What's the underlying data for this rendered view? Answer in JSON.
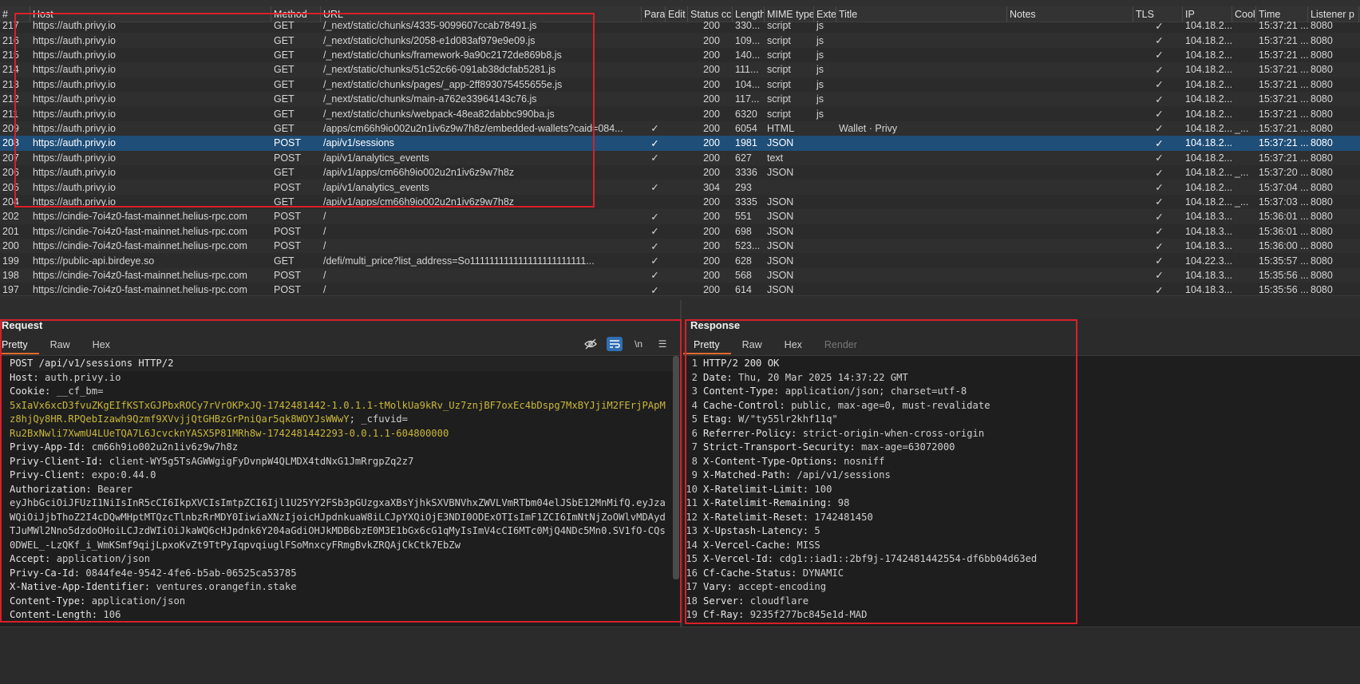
{
  "table": {
    "columns": [
      "#",
      "Host",
      "Method",
      "URL",
      "Params",
      "Edited",
      "Status code",
      "Length",
      "MIME type",
      "Extension",
      "Title",
      "Notes",
      "TLS",
      "IP",
      "Cookies",
      "Time",
      "Listener port"
    ],
    "headers": {
      "num": "#",
      "host": "Host",
      "method": "Method",
      "url": "URL",
      "params": "Parar",
      "edited": "Edit",
      "status": "Status cc",
      "length": "Length",
      "mime": "MIME type",
      "ext": "Exter",
      "title": "Title",
      "notes": "Notes",
      "tls": "TLS",
      "ip": "IP",
      "cookies": "Cool",
      "time": "Time",
      "listener": "Listener p"
    },
    "rows": [
      {
        "num": "217",
        "host": "https://auth.privy.io",
        "method": "GET",
        "url": "/_next/static/chunks/4335-9099607ccab78491.js",
        "params": "",
        "status": "200",
        "length": "330...",
        "mime": "script",
        "ext": "js",
        "title": "",
        "tls": "✓",
        "ip": "104.18.2...",
        "cookies": "",
        "time": "15:37:21 ...",
        "listener": "8080"
      },
      {
        "num": "216",
        "host": "https://auth.privy.io",
        "method": "GET",
        "url": "/_next/static/chunks/2058-e1d083af979e9e09.js",
        "params": "",
        "status": "200",
        "length": "109...",
        "mime": "script",
        "ext": "js",
        "title": "",
        "tls": "✓",
        "ip": "104.18.2...",
        "cookies": "",
        "time": "15:37:21 ...",
        "listener": "8080"
      },
      {
        "num": "215",
        "host": "https://auth.privy.io",
        "method": "GET",
        "url": "/_next/static/chunks/framework-9a90c2172de869b8.js",
        "params": "",
        "status": "200",
        "length": "140...",
        "mime": "script",
        "ext": "js",
        "title": "",
        "tls": "✓",
        "ip": "104.18.2...",
        "cookies": "",
        "time": "15:37:21 ...",
        "listener": "8080"
      },
      {
        "num": "214",
        "host": "https://auth.privy.io",
        "method": "GET",
        "url": "/_next/static/chunks/51c52c66-091ab38dcfab5281.js",
        "params": "",
        "status": "200",
        "length": "111...",
        "mime": "script",
        "ext": "js",
        "title": "",
        "tls": "✓",
        "ip": "104.18.2...",
        "cookies": "",
        "time": "15:37:21 ...",
        "listener": "8080"
      },
      {
        "num": "213",
        "host": "https://auth.privy.io",
        "method": "GET",
        "url": "/_next/static/chunks/pages/_app-2ff893075455655e.js",
        "params": "",
        "status": "200",
        "length": "104...",
        "mime": "script",
        "ext": "js",
        "title": "",
        "tls": "✓",
        "ip": "104.18.2...",
        "cookies": "",
        "time": "15:37:21 ...",
        "listener": "8080"
      },
      {
        "num": "212",
        "host": "https://auth.privy.io",
        "method": "GET",
        "url": "/_next/static/chunks/main-a762e33964143c76.js",
        "params": "",
        "status": "200",
        "length": "117...",
        "mime": "script",
        "ext": "js",
        "title": "",
        "tls": "✓",
        "ip": "104.18.2...",
        "cookies": "",
        "time": "15:37:21 ...",
        "listener": "8080"
      },
      {
        "num": "211",
        "host": "https://auth.privy.io",
        "method": "GET",
        "url": "/_next/static/chunks/webpack-48ea82dabbc990ba.js",
        "params": "",
        "status": "200",
        "length": "6320",
        "mime": "script",
        "ext": "js",
        "title": "",
        "tls": "✓",
        "ip": "104.18.2...",
        "cookies": "",
        "time": "15:37:21 ...",
        "listener": "8080"
      },
      {
        "num": "209",
        "host": "https://auth.privy.io",
        "method": "GET",
        "url": "/apps/cm66h9io002u2n1iv6z9w7h8z/embedded-wallets?caid=084...",
        "params": "✓",
        "status": "200",
        "length": "6054",
        "mime": "HTML",
        "ext": "",
        "title": "Wallet · Privy",
        "tls": "✓",
        "ip": "104.18.2...",
        "cookies": "_...",
        "time": "15:37:21 ...",
        "listener": "8080"
      },
      {
        "num": "208",
        "host": "https://auth.privy.io",
        "method": "POST",
        "url": "/api/v1/sessions",
        "params": "✓",
        "status": "200",
        "length": "1981",
        "mime": "JSON",
        "ext": "",
        "title": "",
        "tls": "✓",
        "ip": "104.18.2...",
        "cookies": "",
        "time": "15:37:21 ...",
        "listener": "8080",
        "selected": true
      },
      {
        "num": "207",
        "host": "https://auth.privy.io",
        "method": "POST",
        "url": "/api/v1/analytics_events",
        "params": "✓",
        "status": "200",
        "length": "627",
        "mime": "text",
        "ext": "",
        "title": "",
        "tls": "✓",
        "ip": "104.18.2...",
        "cookies": "",
        "time": "15:37:21 ...",
        "listener": "8080"
      },
      {
        "num": "206",
        "host": "https://auth.privy.io",
        "method": "GET",
        "url": "/api/v1/apps/cm66h9io002u2n1iv6z9w7h8z",
        "params": "",
        "status": "200",
        "length": "3336",
        "mime": "JSON",
        "ext": "",
        "title": "",
        "tls": "✓",
        "ip": "104.18.2...",
        "cookies": "_...",
        "time": "15:37:20 ...",
        "listener": "8080"
      },
      {
        "num": "205",
        "host": "https://auth.privy.io",
        "method": "POST",
        "url": "/api/v1/analytics_events",
        "params": "✓",
        "status": "304",
        "length": "293",
        "mime": "",
        "ext": "",
        "title": "",
        "tls": "✓",
        "ip": "104.18.2...",
        "cookies": "",
        "time": "15:37:04 ...",
        "listener": "8080"
      },
      {
        "num": "204",
        "host": "https://auth.privy.io",
        "method": "GET",
        "url": "/api/v1/apps/cm66h9io002u2n1iv6z9w7h8z",
        "params": "",
        "status": "200",
        "length": "3335",
        "mime": "JSON",
        "ext": "",
        "title": "",
        "tls": "✓",
        "ip": "104.18.2...",
        "cookies": "_...",
        "time": "15:37:03 ...",
        "listener": "8080"
      },
      {
        "num": "202",
        "host": "https://cindie-7oi4z0-fast-mainnet.helius-rpc.com",
        "method": "POST",
        "url": "/",
        "params": "✓",
        "status": "200",
        "length": "551",
        "mime": "JSON",
        "ext": "",
        "title": "",
        "tls": "✓",
        "ip": "104.18.3...",
        "cookies": "",
        "time": "15:36:01 ...",
        "listener": "8080"
      },
      {
        "num": "201",
        "host": "https://cindie-7oi4z0-fast-mainnet.helius-rpc.com",
        "method": "POST",
        "url": "/",
        "params": "✓",
        "status": "200",
        "length": "698",
        "mime": "JSON",
        "ext": "",
        "title": "",
        "tls": "✓",
        "ip": "104.18.3...",
        "cookies": "",
        "time": "15:36:01 ...",
        "listener": "8080"
      },
      {
        "num": "200",
        "host": "https://cindie-7oi4z0-fast-mainnet.helius-rpc.com",
        "method": "POST",
        "url": "/",
        "params": "✓",
        "status": "200",
        "length": "523...",
        "mime": "JSON",
        "ext": "",
        "title": "",
        "tls": "✓",
        "ip": "104.18.3...",
        "cookies": "",
        "time": "15:36:00 ...",
        "listener": "8080"
      },
      {
        "num": "199",
        "host": "https://public-api.birdeye.so",
        "method": "GET",
        "url": "/defi/multi_price?list_address=So111111111111111111111111...",
        "params": "✓",
        "status": "200",
        "length": "628",
        "mime": "JSON",
        "ext": "",
        "title": "",
        "tls": "✓",
        "ip": "104.22.3...",
        "cookies": "",
        "time": "15:35:57 ...",
        "listener": "8080"
      },
      {
        "num": "198",
        "host": "https://cindie-7oi4z0-fast-mainnet.helius-rpc.com",
        "method": "POST",
        "url": "/",
        "params": "✓",
        "status": "200",
        "length": "568",
        "mime": "JSON",
        "ext": "",
        "title": "",
        "tls": "✓",
        "ip": "104.18.3...",
        "cookies": "",
        "time": "15:35:56 ...",
        "listener": "8080"
      },
      {
        "num": "197",
        "host": "https://cindie-7oi4z0-fast-mainnet.helius-rpc.com",
        "method": "POST",
        "url": "/",
        "params": "✓",
        "status": "200",
        "length": "614",
        "mime": "JSON",
        "ext": "",
        "title": "",
        "tls": "✓",
        "ip": "104.18.3...",
        "cookies": "",
        "time": "15:35:56 ...",
        "listener": "8080"
      }
    ]
  },
  "request": {
    "title": "Request",
    "tabs": [
      "Pretty",
      "Raw",
      "Hex"
    ],
    "tools": {
      "wrap": "\\n",
      "menu": "☰"
    },
    "lines": [
      {
        "k": "POST /api/v1/sessions HTTP/2",
        "v": ""
      },
      {
        "k": "Host: ",
        "v": "auth.privy.io"
      },
      {
        "k": "Cookie: ",
        "v": "__cf_bm="
      },
      {
        "g": "5xIaVx6xcD3fvuZKgEIfKSTxGJPbxROCy7rVrOKPxJQ-1742481442-1.0.1.1-tMolkUa9kRv_Uz7znjBF7oxEc4bDspg7MxBYJjiM2FErjPApM"
      },
      {
        "g": "z8hjQy8HR.RPQebIzawh9Qzmf9XVvjjQtGHBzGrPniQar5qk8WOYJsWWwY",
        "v": "; _cfuvid="
      },
      {
        "g": "Ru2BxNwli7XwmU4LUeTQA7L6JcvcknYASX5P81MRh8w-1742481442293-0.0.1.1-604800000"
      },
      {
        "k": "Privy-App-Id: ",
        "v": "cm66h9io002u2n1iv6z9w7h8z"
      },
      {
        "k": "Privy-Client-Id: ",
        "v": "client-WY5g5TsAGWWgigFyDvnpW4QLMDX4tdNxG1JmRrgpZq2z7"
      },
      {
        "k": "Privy-Client: ",
        "v": "expo:0.44.0"
      },
      {
        "k": "Authorization: ",
        "v": "Bearer"
      },
      {
        "v": "eyJhbGciOiJFUzI1NiIsInR5cCI6IkpXVCIsImtpZCI6Ijl1U25YY2FSb3pGUzgxaXBsYjhkSXVBNVhxZWVLVmRTbm04elJSbE12MnMifQ.eyJza"
      },
      {
        "v": "WQiOiJjbThoZ2I4cDQwMHptMTQzcTlnbzRrMDY0IiwiaXNzIjoicHJpdnkuaW8iLCJpYXQiOjE3NDI0ODExOTIsImF1ZCI6ImNtNjZoOWlvMDAyd"
      },
      {
        "v": "TJuMWl2Nno5dzdoOHoiLCJzdWIiOiJkaWQ6cHJpdnk6Y204aGdiOHJkMDB6bzE0M3E1bGx6cG1qMyIsImV4cCI6MTc0MjQ4NDc5Mn0.SV1fO-CQs"
      },
      {
        "v": "0DWEL_-LzQKf_i_WmKSmf9qijLpxoKvZt9TtPyIqpvqiuglFSoMnxcyFRmgBvkZRQAjCkCtk7EbZw"
      },
      {
        "k": "Accept: ",
        "v": "application/json"
      },
      {
        "k": "Privy-Ca-Id: ",
        "v": "0844fe4e-9542-4fe6-b5ab-06525ca53785"
      },
      {
        "k": "X-Native-App-Identifier: ",
        "v": "ventures.orangefin.stake"
      },
      {
        "k": "Content-Type: ",
        "v": "application/json"
      },
      {
        "k": "Content-Length: ",
        "v": "106"
      }
    ]
  },
  "response": {
    "title": "Response",
    "tabs": [
      "Pretty",
      "Raw",
      "Hex",
      "Render"
    ],
    "lines": [
      {
        "n": "1",
        "k": "HTTP/2 200 OK",
        "v": ""
      },
      {
        "n": "2",
        "k": "Date: ",
        "v": "Thu, 20 Mar 2025 14:37:22 GMT"
      },
      {
        "n": "3",
        "k": "Content-Type: ",
        "v": "application/json; charset=utf-8"
      },
      {
        "n": "4",
        "k": "Cache-Control: ",
        "v": "public, max-age=0, must-revalidate"
      },
      {
        "n": "5",
        "k": "Etag: ",
        "v": "W/\"ty55lr2khf11q\""
      },
      {
        "n": "6",
        "k": "Referrer-Policy: ",
        "v": "strict-origin-when-cross-origin"
      },
      {
        "n": "7",
        "k": "Strict-Transport-Security: ",
        "v": "max-age=63072000"
      },
      {
        "n": "8",
        "k": "X-Content-Type-Options: ",
        "v": "nosniff"
      },
      {
        "n": "9",
        "k": "X-Matched-Path: ",
        "v": "/api/v1/sessions"
      },
      {
        "n": "10",
        "k": "X-Ratelimit-Limit: ",
        "v": "100"
      },
      {
        "n": "11",
        "k": "X-Ratelimit-Remaining: ",
        "v": "98"
      },
      {
        "n": "12",
        "k": "X-Ratelimit-Reset: ",
        "v": "1742481450"
      },
      {
        "n": "13",
        "k": "X-Upstash-Latency: ",
        "v": "5"
      },
      {
        "n": "14",
        "k": "X-Vercel-Cache: ",
        "v": "MISS"
      },
      {
        "n": "15",
        "k": "X-Vercel-Id: ",
        "v": "cdg1::iad1::2bf9j-1742481442554-df6bb04d63ed"
      },
      {
        "n": "16",
        "k": "Cf-Cache-Status: ",
        "v": "DYNAMIC"
      },
      {
        "n": "17",
        "k": "Vary: ",
        "v": "accept-encoding"
      },
      {
        "n": "18",
        "k": "Server: ",
        "v": "cloudflare"
      },
      {
        "n": "19",
        "k": "Cf-Ray: ",
        "v": "9235f277bc845e1d-MAD"
      }
    ]
  },
  "colors": {
    "selection": "#1f4e78",
    "highlight_border": "#d8202a",
    "tab_accent": "#e06b2c",
    "cookie_value": "#c9b73a"
  }
}
